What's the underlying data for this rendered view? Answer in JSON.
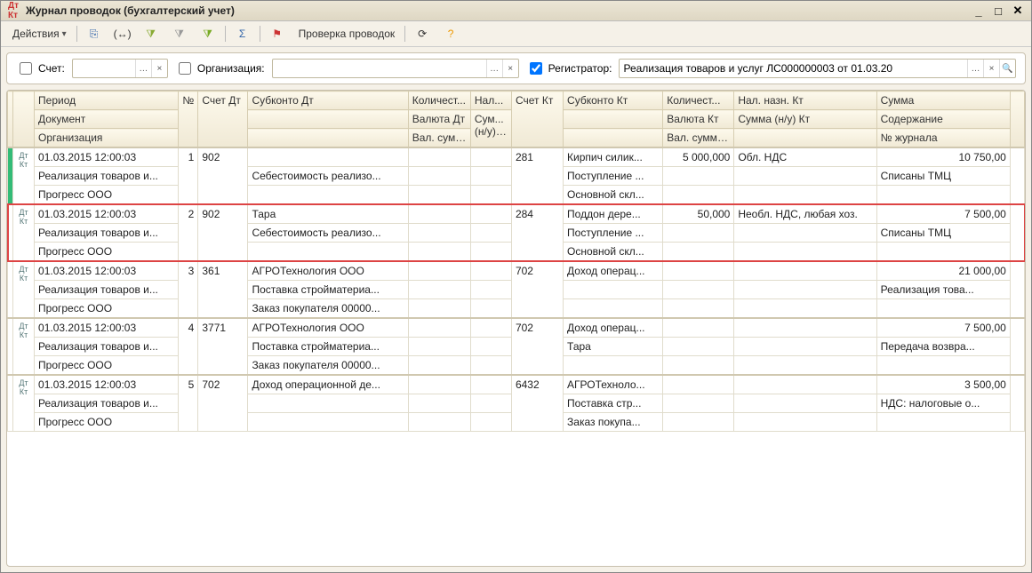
{
  "window": {
    "title": "Журнал проводок (бухгалтерский учет)"
  },
  "toolbar": {
    "actions_label": "Действия"
  },
  "link": {
    "check_label": "Проверка проводок"
  },
  "filter": {
    "account_label": "Счет:",
    "org_label": "Организация:",
    "reg_label": "Регистратор:",
    "reg_value": "Реализация товаров и услуг ЛС000000003 от 01.03.20"
  },
  "headers": {
    "period": "Период",
    "n": "№",
    "acc_dt": "Счет Дт",
    "sub_dt": "Субконто Дт",
    "qty_dt": "Количест...",
    "nal_dt": "Нал...",
    "acc_kt": "Счет Кт",
    "sub_kt": "Субконто Кт",
    "qty_kt": "Количест...",
    "nal_kt": "Нал. назн. Кт",
    "sum": "Сумма",
    "document": "Документ",
    "val_dt": "Валюта Дт",
    "sum_nu_dt": "Сум...",
    "nu_dt": "(н/у) Дт",
    "val_kt": "Валюта Кт",
    "sum_nu_kt": "Сумма (н/у) Кт",
    "content": "Содержание",
    "org": "Организация",
    "valsum_dt": "Вал. сумма Дт",
    "valsum_kt": "Вал. сумма Кт",
    "journal": "№ журнала"
  },
  "rows": [
    {
      "period": "01.03.2015 12:00:03",
      "n": "1",
      "acc_dt": "902",
      "sub_dt1": "",
      "sub_dt2": "Себестоимость реализо...",
      "sub_dt3": "",
      "acc_kt": "281",
      "sub_kt1": "Кирпич силик...",
      "sub_kt2": "Поступление ...",
      "sub_kt3": "Основной скл...",
      "qty_kt": "5 000,000",
      "nal_kt": "Обл. НДС",
      "sum": "10 750,00",
      "content": "Списаны ТМЦ",
      "doc": "Реализация товаров и...",
      "org": "Прогресс ООО",
      "highlight": false,
      "selected": true
    },
    {
      "period": "01.03.2015 12:00:03",
      "n": "2",
      "acc_dt": "902",
      "sub_dt1": "Тара",
      "sub_dt2": "Себестоимость реализо...",
      "sub_dt3": "",
      "acc_kt": "284",
      "sub_kt1": "Поддон дере...",
      "sub_kt2": "Поступление ...",
      "sub_kt3": "Основной скл...",
      "qty_kt": "50,000",
      "nal_kt": "Необл. НДС, любая хоз.",
      "sum": "7 500,00",
      "content": "Списаны ТМЦ",
      "doc": "Реализация товаров и...",
      "org": "Прогресс ООО",
      "highlight": true
    },
    {
      "period": "01.03.2015 12:00:03",
      "n": "3",
      "acc_dt": "361",
      "sub_dt1": "АГРОТехнология ООО",
      "sub_dt2": "Поставка стройматериа...",
      "sub_dt3": "Заказ покупателя 00000...",
      "acc_kt": "702",
      "sub_kt1": "Доход операц...",
      "sub_kt2": "",
      "sub_kt3": "",
      "qty_kt": "",
      "nal_kt": "",
      "sum": "21 000,00",
      "content": "Реализация това...",
      "doc": "Реализация товаров и...",
      "org": "Прогресс ООО",
      "highlight": false
    },
    {
      "period": "01.03.2015 12:00:03",
      "n": "4",
      "acc_dt": "3771",
      "sub_dt1": "АГРОТехнология ООО",
      "sub_dt2": "Поставка стройматериа...",
      "sub_dt3": "Заказ покупателя 00000...",
      "acc_kt": "702",
      "sub_kt1": "Доход операц...",
      "sub_kt2": "Тара",
      "sub_kt3": "",
      "qty_kt": "",
      "nal_kt": "",
      "sum": "7 500,00",
      "content": "Передача возвра...",
      "doc": "Реализация товаров и...",
      "org": "Прогресс ООО",
      "highlight": false
    },
    {
      "period": "01.03.2015 12:00:03",
      "n": "5",
      "acc_dt": "702",
      "sub_dt1": "Доход операционной де...",
      "sub_dt2": "",
      "sub_dt3": "",
      "acc_kt": "6432",
      "sub_kt1": "АГРОТехноло...",
      "sub_kt2": "Поставка стр...",
      "sub_kt3": "Заказ покупа...",
      "qty_kt": "",
      "nal_kt": "",
      "sum": "3 500,00",
      "content": "НДС: налоговые о...",
      "doc": "Реализация товаров и...",
      "org": "Прогресс ООО",
      "highlight": false
    }
  ]
}
